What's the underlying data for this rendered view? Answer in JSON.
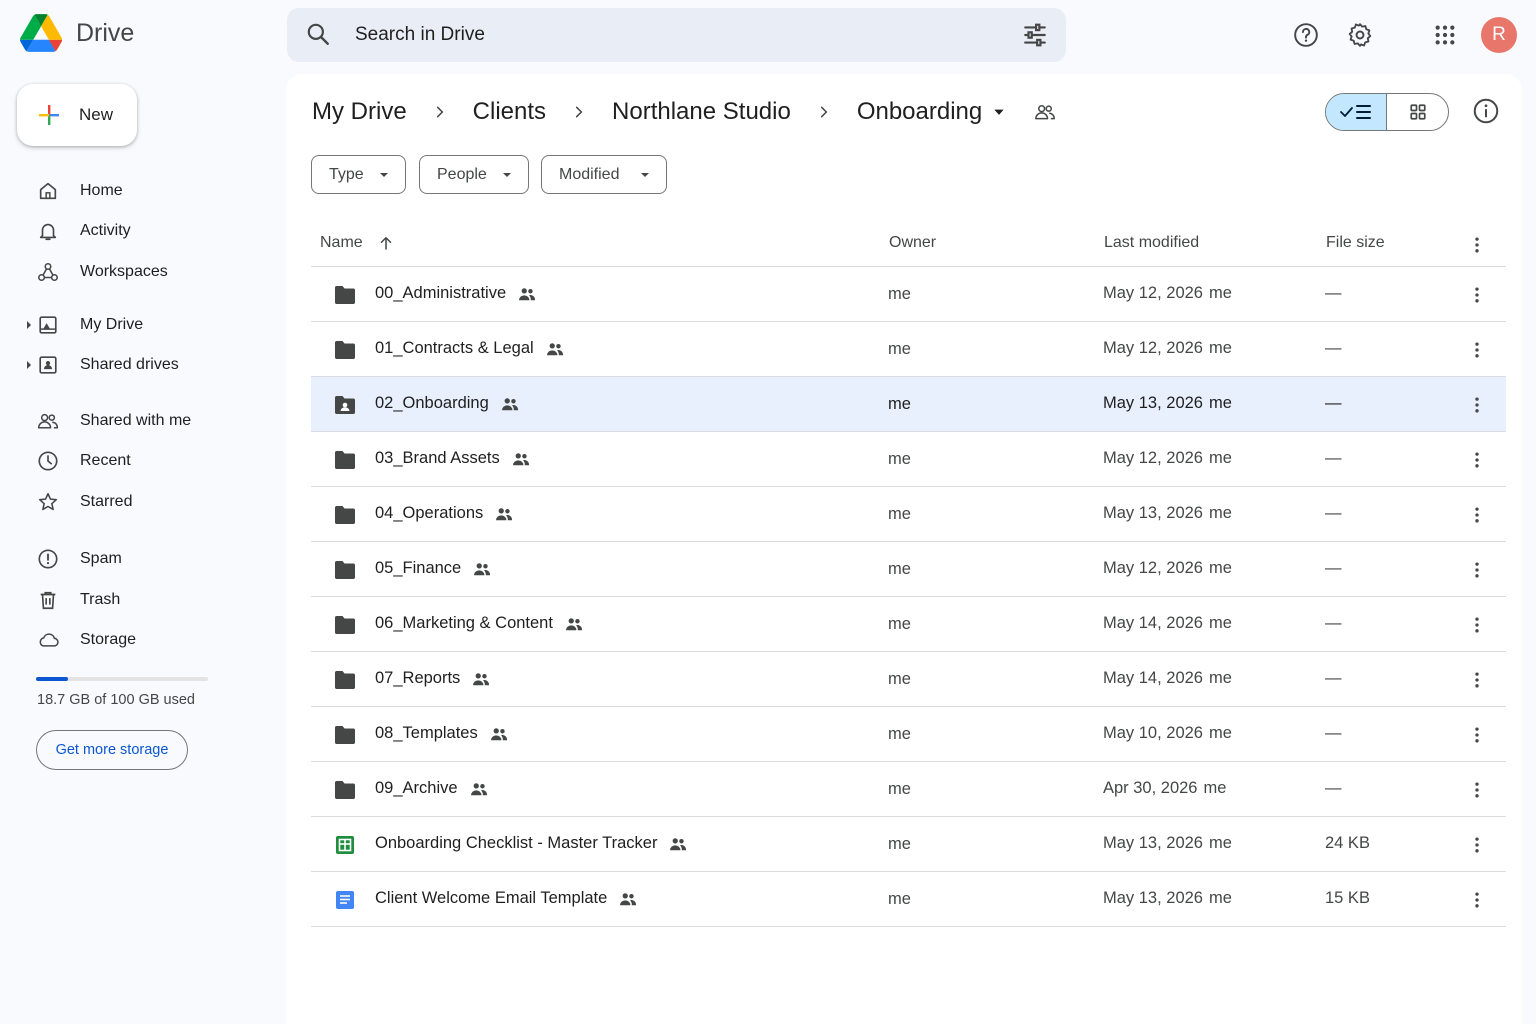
{
  "app": {
    "name": "Drive"
  },
  "search": {
    "placeholder": "Search in Drive"
  },
  "topbar": {
    "avatar_initial": "R"
  },
  "sidebar": {
    "new_label": "New",
    "items": [
      {
        "label": "Home",
        "icon": "home-icon"
      },
      {
        "label": "Activity",
        "icon": "bell-icon"
      },
      {
        "label": "Workspaces",
        "icon": "workspaces-icon"
      },
      {
        "label": "My Drive",
        "icon": "my-drive-icon"
      },
      {
        "label": "Shared drives",
        "icon": "shared-drives-icon"
      },
      {
        "label": "Shared with me",
        "icon": "people-icon"
      },
      {
        "label": "Recent",
        "icon": "clock-icon"
      },
      {
        "label": "Starred",
        "icon": "star-icon"
      },
      {
        "label": "Spam",
        "icon": "spam-icon"
      },
      {
        "label": "Trash",
        "icon": "trash-icon"
      },
      {
        "label": "Storage",
        "icon": "cloud-icon"
      }
    ],
    "storage": {
      "used_text": "18.7 GB of 100 GB used",
      "fraction_used": 0.187,
      "cta": "Get more storage"
    }
  },
  "breadcrumb": {
    "items": [
      "My Drive",
      "Clients",
      "Northlane Studio"
    ],
    "current": "Onboarding"
  },
  "filters": [
    "Type",
    "People",
    "Modified"
  ],
  "table": {
    "headers": {
      "name": "Name",
      "owner": "Owner",
      "modified": "Last modified",
      "size": "File size"
    },
    "rows": [
      {
        "name": "00_Administrative",
        "type": "folder",
        "owner": "me",
        "modified": "May 12, 2026",
        "by": "me",
        "size": "—"
      },
      {
        "name": "01_Contracts & Legal",
        "type": "folder",
        "owner": "me",
        "modified": "May 12, 2026",
        "by": "me",
        "size": "—"
      },
      {
        "name": "02_Onboarding",
        "type": "shared-folder",
        "owner": "me",
        "modified": "May 13, 2026",
        "by": "me",
        "size": "—",
        "selected": true
      },
      {
        "name": "03_Brand Assets",
        "type": "folder",
        "owner": "me",
        "modified": "May 12, 2026",
        "by": "me",
        "size": "—"
      },
      {
        "name": "04_Operations",
        "type": "folder",
        "owner": "me",
        "modified": "May 13, 2026",
        "by": "me",
        "size": "—"
      },
      {
        "name": "05_Finance",
        "type": "folder",
        "owner": "me",
        "modified": "May 12, 2026",
        "by": "me",
        "size": "—"
      },
      {
        "name": "06_Marketing & Content",
        "type": "folder",
        "owner": "me",
        "modified": "May 14, 2026",
        "by": "me",
        "size": "—"
      },
      {
        "name": "07_Reports",
        "type": "folder",
        "owner": "me",
        "modified": "May 14, 2026",
        "by": "me",
        "size": "—"
      },
      {
        "name": "08_Templates",
        "type": "folder",
        "owner": "me",
        "modified": "May 10, 2026",
        "by": "me",
        "size": "—"
      },
      {
        "name": "09_Archive",
        "type": "folder",
        "owner": "me",
        "modified": "Apr 30, 2026",
        "by": "me",
        "size": "—"
      },
      {
        "name": "Onboarding Checklist - Master Tracker",
        "type": "sheet",
        "owner": "me",
        "modified": "May 13, 2026",
        "by": "me",
        "size": "24 KB"
      },
      {
        "name": "Client Welcome Email Template",
        "type": "doc",
        "owner": "me",
        "modified": "May 13, 2026",
        "by": "me",
        "size": "15 KB"
      }
    ]
  },
  "colors": {
    "accent": "#0b57d0",
    "selected_row": "#e8f0fe",
    "sheet_green": "#1e8e3e",
    "doc_blue": "#4285f4",
    "avatar": "#e8766b"
  }
}
